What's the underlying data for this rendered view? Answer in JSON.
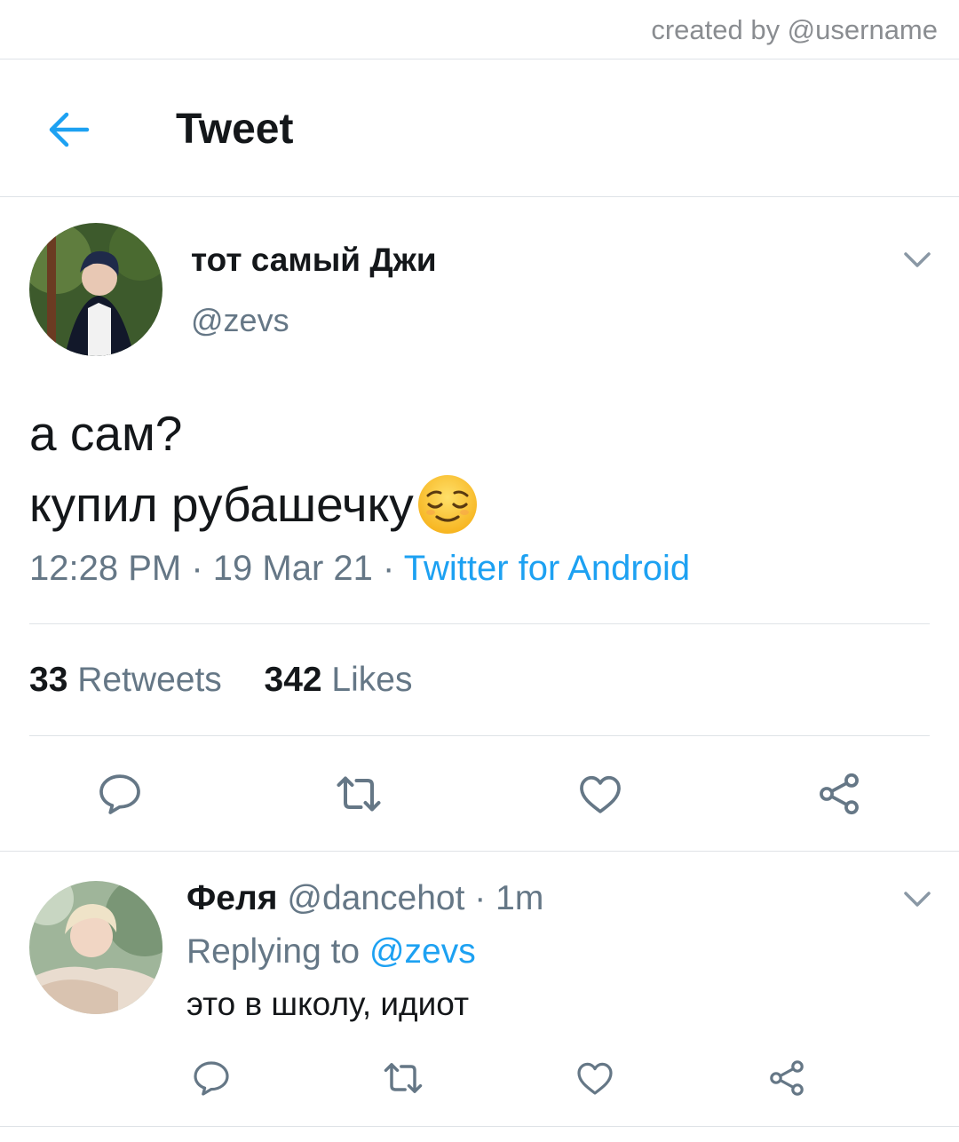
{
  "watermark": "created by @username",
  "header": {
    "title": "Tweet"
  },
  "tweet": {
    "display_name": "тот самый Джи",
    "handle": "@zevs",
    "text_line1": "а сам?",
    "text_line2": "купил рубашечку",
    "emoji": "relieved-face",
    "time": "12:28 PM",
    "sep1": "·",
    "date": "19 Mar 21",
    "sep2": "·",
    "source": "Twitter for Android",
    "retweets_count": "33",
    "retweets_label": "Retweets",
    "likes_count": "342",
    "likes_label": "Likes"
  },
  "reply": {
    "display_name": "Феля",
    "handle": "@dancehot",
    "sep": "·",
    "age": "1m",
    "replying_prefix": "Replying to",
    "replying_handle": "@zevs",
    "text": "это в школу, идиот"
  },
  "colors": {
    "accent": "#1da1f2",
    "secondary": "#657786",
    "divider": "#dfe3e7"
  }
}
